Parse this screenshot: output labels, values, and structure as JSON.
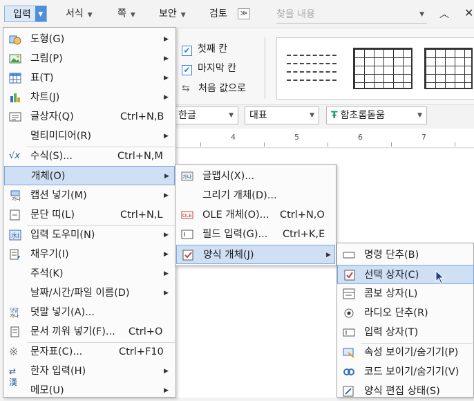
{
  "toolbar": {
    "tabs": [
      "입력",
      "서식",
      "쪽",
      "보안",
      "검토"
    ],
    "more": "≫",
    "search_placeholder": "찾을 내용"
  },
  "ribbon": {
    "check1": "첫째 칸",
    "check2": "마지막 칸",
    "reset": "처음 값으로"
  },
  "format": {
    "lang": "한글",
    "style": "대표",
    "font": "함초롬돋움"
  },
  "ruler": [
    "4",
    "5",
    "6",
    "7"
  ],
  "menu": {
    "items": [
      {
        "label": "도형(G)",
        "shortcut": ""
      },
      {
        "label": "그림(P)",
        "shortcut": ""
      },
      {
        "label": "표(T)",
        "shortcut": ""
      },
      {
        "label": "차트(J)",
        "shortcut": ""
      },
      {
        "label": "글상자(Q)",
        "shortcut": "Ctrl+N,B"
      },
      {
        "label": "멀티미디어(R)",
        "shortcut": ""
      },
      {
        "label": "수식(S)...",
        "shortcut": "Ctrl+N,M"
      },
      {
        "label": "개체(O)",
        "shortcut": ""
      },
      {
        "label": "캡션 넣기(M)",
        "shortcut": ""
      },
      {
        "label": "문단 띠(L)",
        "shortcut": "Ctrl+N,L"
      },
      {
        "label": "입력 도우미(N)",
        "shortcut": ""
      },
      {
        "label": "채우기(I)",
        "shortcut": ""
      },
      {
        "label": "주석(K)",
        "shortcut": ""
      },
      {
        "label": "날짜/시간/파일 이름(D)",
        "shortcut": ""
      },
      {
        "label": "덧말 넣기(A)...",
        "shortcut": ""
      },
      {
        "label": "문서 끼워 넣기(F)...",
        "shortcut": "Ctrl+O"
      },
      {
        "label": "문자표(C)...",
        "shortcut": "Ctrl+F10"
      },
      {
        "label": "한자 입력(H)",
        "shortcut": ""
      },
      {
        "label": "메모(U)",
        "shortcut": ""
      }
    ]
  },
  "submenu": {
    "items": [
      {
        "label": "글맵시(X)...",
        "shortcut": ""
      },
      {
        "label": "그리기 개체(D)...",
        "shortcut": ""
      },
      {
        "label": "OLE 개체(O)...",
        "shortcut": "Ctrl+N,O"
      },
      {
        "label": "필드 입력(G)...",
        "shortcut": "Ctrl+K,E"
      },
      {
        "label": "양식 개체(J)",
        "shortcut": ""
      }
    ]
  },
  "formmenu": {
    "items": [
      {
        "label": "명령 단추(B)"
      },
      {
        "label": "선택 상자(C)"
      },
      {
        "label": "콤보 상자(L)"
      },
      {
        "label": "라디오 단추(R)"
      },
      {
        "label": "입력 상자(T)"
      },
      {
        "label": "속성 보이기/숨기기(P)"
      },
      {
        "label": "코드 보이기/숨기기(V)"
      },
      {
        "label": "양식 편집 상태(S)"
      }
    ]
  },
  "colors": {
    "accent": "#4f8fd8",
    "highlight": "#cfe0f5"
  }
}
